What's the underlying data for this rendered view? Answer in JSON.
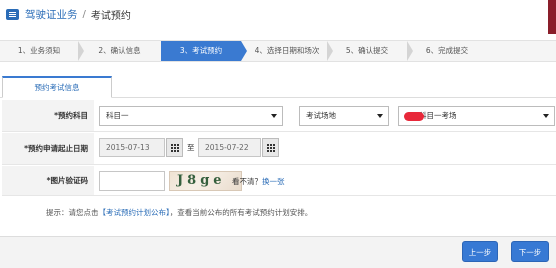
{
  "header": {
    "root": "驾驶证业务",
    "separator": "/",
    "current": "考试预约"
  },
  "steps": [
    {
      "label": "1、业务须知",
      "active": false
    },
    {
      "label": "2、确认信息",
      "active": false
    },
    {
      "label": "3、考试预约",
      "active": true
    },
    {
      "label": "4、选择日期和场次",
      "active": false
    },
    {
      "label": "5、确认提交",
      "active": false
    },
    {
      "label": "6、完成提交",
      "active": false
    }
  ],
  "tab": {
    "label": "预约考试信息"
  },
  "form": {
    "subject_label": "*预约科目",
    "subject_value": "科目一",
    "venue_value": "考试场地",
    "venue_detail_value": "科目一考场",
    "date_label": "*预约申请起止日期",
    "date_start": "2015-07-13",
    "date_to": "至",
    "date_end": "2015-07-22",
    "captcha_label": "*图片验证码",
    "captcha_text": "J8ge",
    "captcha_hint": "看不清？",
    "captcha_refresh": "换一张"
  },
  "hint": {
    "prefix": "提示：请您点击",
    "link": "【考试预约计划公布】",
    "suffix": "，查看当前公布的所有考试预约计划安排。"
  },
  "buttons": {
    "prev": "上一步",
    "next": "下一步"
  },
  "colors": {
    "accent": "#3a7ad1",
    "link": "#2a6cb7",
    "redacted": "#e8283a"
  }
}
